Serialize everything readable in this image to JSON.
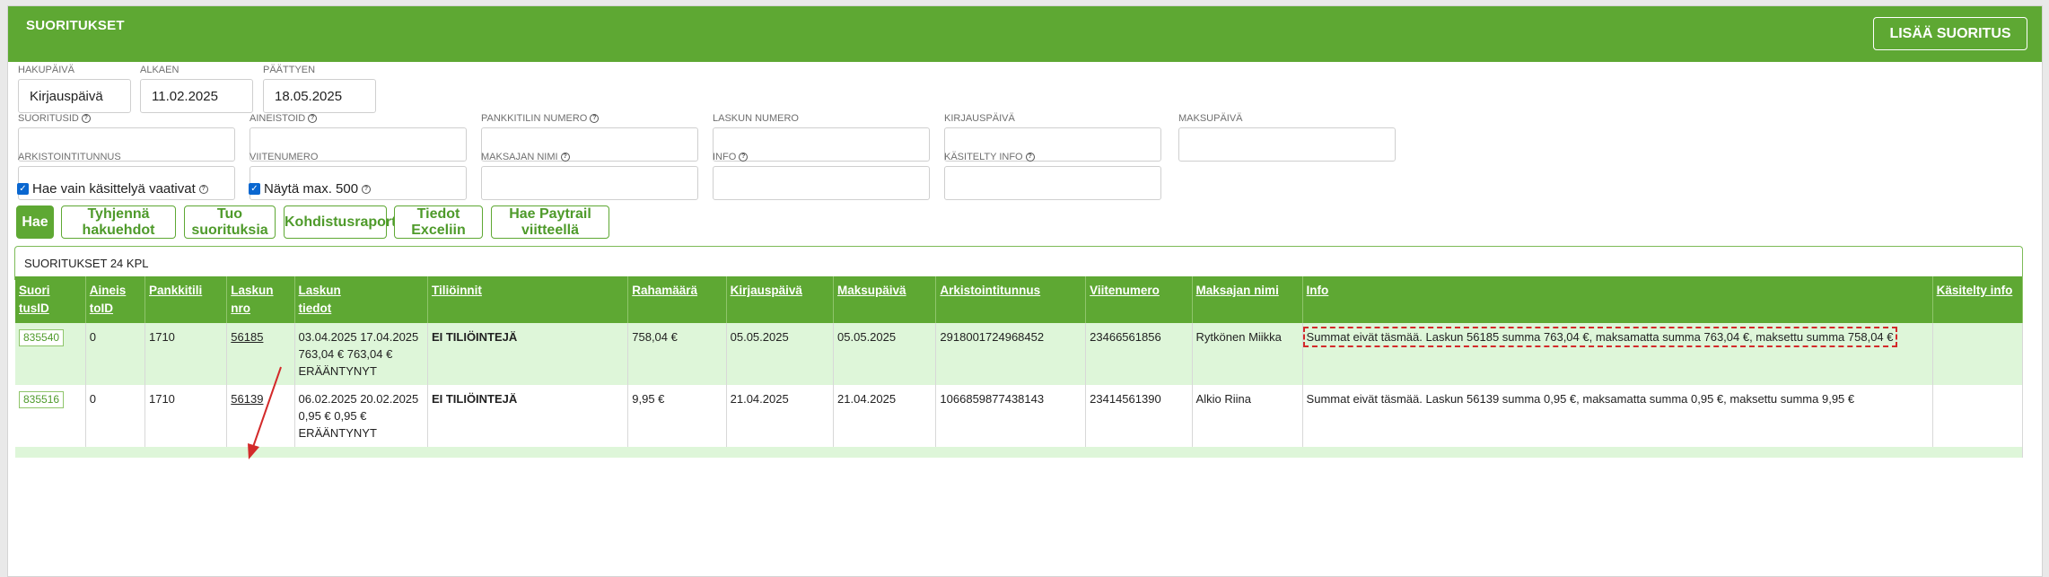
{
  "header": {
    "title": "SUORITUKSET",
    "add_button": "LISÄÄ SUORITUS"
  },
  "date_filters": [
    {
      "label": "HAKUPÄIVÄ",
      "value": "Kirjauspäivä"
    },
    {
      "label": "ALKAEN",
      "value": "11.02.2025"
    },
    {
      "label": "PÄÄTTYEN",
      "value": "18.05.2025"
    }
  ],
  "filters_row1": [
    {
      "label": "SUORITUSID",
      "help": true
    },
    {
      "label": "AINEISTOID",
      "help": true
    },
    {
      "label": "PANKKITILIN NUMERO",
      "help": true
    },
    {
      "label": "LASKUN NUMERO",
      "help": false
    },
    {
      "label": "KIRJAUSPÄIVÄ",
      "help": false
    },
    {
      "label": "MAKSUPÄIVÄ",
      "help": false
    }
  ],
  "filters_row2": [
    {
      "label": "ARKISTOINTITUNNUS",
      "help": false
    },
    {
      "label": "VIITENUMERO",
      "help": false
    },
    {
      "label": "MAKSAJAN NIMI",
      "help": true
    },
    {
      "label": "INFO",
      "help": true
    },
    {
      "label": "KÄSITELTY INFO",
      "help": true
    }
  ],
  "checkboxes": [
    {
      "label": "Hae vain käsittelyä vaativat",
      "checked": true
    },
    {
      "label": "Näytä max. 500",
      "checked": true
    }
  ],
  "buttons": [
    "Hae",
    "Tyhjennä hakuehdot",
    "Tuo suorituksia",
    "Kohdistusraportti",
    "Tiedot Exceliin",
    "Hae Paytrail viitteellä"
  ],
  "results": {
    "count_label": "SUORITUKSET 24 KPL",
    "columns": [
      [
        "Suori",
        "tusID"
      ],
      [
        "Aineis",
        "toID"
      ],
      [
        "Pankkitili",
        ""
      ],
      [
        "Laskun",
        "nro"
      ],
      [
        "Laskun",
        "tiedot"
      ],
      [
        "Tiliöinnit",
        ""
      ],
      [
        "Rahamäärä",
        ""
      ],
      [
        "Kirjauspäivä",
        ""
      ],
      [
        "Maksupäivä",
        ""
      ],
      [
        "Arkistointitunnus",
        ""
      ],
      [
        "Viitenumero",
        ""
      ],
      [
        "Maksajan nimi",
        ""
      ],
      [
        "Info",
        ""
      ],
      [
        "Käsitelty info",
        ""
      ]
    ],
    "rows": [
      {
        "id": "835540",
        "aineisto": "0",
        "tili": "1710",
        "laskunro": "56185",
        "tiedot": [
          "03.04.2025 17.04.2025",
          "763,04 € 763,04 €",
          "ERÄÄNTYNYT"
        ],
        "tilioinnit": "EI TILIÖINTEJÄ",
        "rahamaara": "758,04 €",
        "kirjaus": "05.05.2025",
        "maksu": "05.05.2025",
        "arkisto": "2918001724968452",
        "viite": "23466561856",
        "maksaja": "Rytkönen Miikka",
        "info": "Summat eivät täsmää. Laskun 56185 summa 763,04 €, maksamatta summa 763,04 €, maksettu summa 758,04 €",
        "kasitelty": ""
      },
      {
        "id": "835516",
        "aineisto": "0",
        "tili": "1710",
        "laskunro": "56139",
        "tiedot": [
          "06.02.2025 20.02.2025",
          "0,95 € 0,95 €",
          "ERÄÄNTYNYT"
        ],
        "tilioinnit": "EI TILIÖINTEJÄ",
        "rahamaara": "9,95 €",
        "kirjaus": "21.04.2025",
        "maksu": "21.04.2025",
        "arkisto": "1066859877438143",
        "viite": "23414561390",
        "maksaja": "Alkio Riina",
        "info": "Summat eivät täsmää. Laskun 56139 summa 0,95 €, maksamatta summa 0,95 €, maksettu summa 9,95 €",
        "kasitelty": ""
      }
    ]
  },
  "colors": {
    "brand_green": "#5ea833",
    "row_highlight": "#def6d9",
    "annotation_red": "#d32a2a"
  }
}
